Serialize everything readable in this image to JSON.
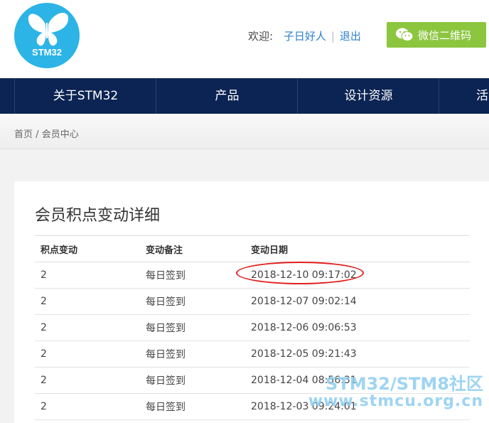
{
  "header": {
    "logo_text": "STM32",
    "welcome_label": "欢迎:",
    "username": "子日好人",
    "logout_label": "退出",
    "wechat_label": "微信二维码"
  },
  "nav": {
    "items": [
      "关于STM32",
      "产品",
      "设计资源",
      "活"
    ]
  },
  "breadcrumb": {
    "home": "首页",
    "separator": "/",
    "current": "会员中心"
  },
  "main": {
    "title": "会员积点变动详细",
    "columns": [
      "积点变动",
      "变动备注",
      "变动日期"
    ],
    "rows": [
      {
        "points": "2",
        "remark": "每日签到",
        "date": "2018-12-10 09:17:02"
      },
      {
        "points": "2",
        "remark": "每日签到",
        "date": "2018-12-07 09:02:14"
      },
      {
        "points": "2",
        "remark": "每日签到",
        "date": "2018-12-06 09:06:53"
      },
      {
        "points": "2",
        "remark": "每日签到",
        "date": "2018-12-05 09:21:43"
      },
      {
        "points": "2",
        "remark": "每日签到",
        "date": "2018-12-04 08:56:31"
      },
      {
        "points": "2",
        "remark": "每日签到",
        "date": "2018-12-03 09:24:01"
      }
    ]
  },
  "watermark": {
    "line1": "STM32/STM8社区",
    "line2": "www.stmcu.org.cn"
  },
  "colors": {
    "nav_bg": "#0c2453",
    "logo_blue": "#2db4e6",
    "wechat_green": "#8cc63f",
    "link_blue": "#2e7fd0",
    "highlight_red": "#e02020"
  }
}
